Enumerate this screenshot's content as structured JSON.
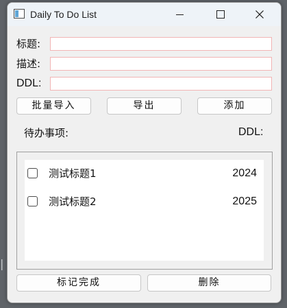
{
  "window": {
    "title": "Daily To Do List",
    "controls": {
      "minimize": "minimize",
      "maximize": "maximize",
      "close": "close"
    }
  },
  "form": {
    "title_label": "标题:",
    "desc_label": "描述:",
    "ddl_label": "DDL:",
    "title_value": "",
    "desc_value": "",
    "ddl_value": ""
  },
  "buttons": {
    "import": "批量导入",
    "export": "导出",
    "add": "添加",
    "mark_done": "标记完成",
    "delete": "删除"
  },
  "list_header": {
    "todo": "待办事项:",
    "ddl": "DDL:"
  },
  "items": [
    {
      "title": "测试标题1",
      "ddl": "2024",
      "checked": false
    },
    {
      "title": "测试标题2",
      "ddl": "2025",
      "checked": false
    }
  ],
  "colors": {
    "window_bg": "#f0f0f0",
    "titlebar_bg": "#eef3f8",
    "input_border": "#f2b4b4"
  }
}
